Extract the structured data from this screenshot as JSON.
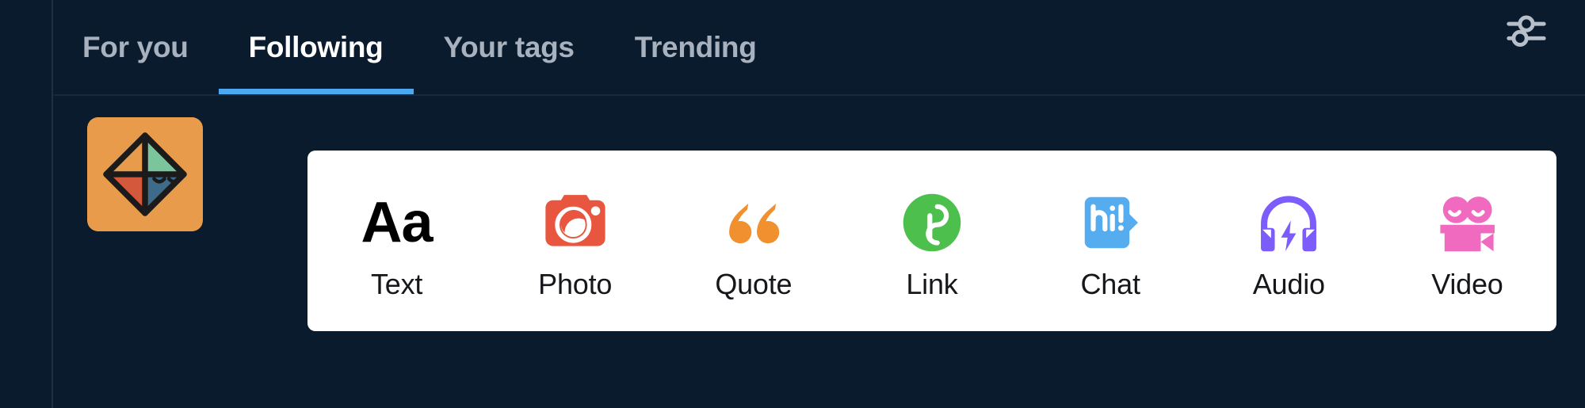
{
  "theme": {
    "background": "#0b1b2e",
    "divider": "#1e3047",
    "accent": "#4ca8f0",
    "tab_inactive": "#a8b2be",
    "tab_active": "#ffffff",
    "card_background": "#ffffff",
    "label_color": "#15171a"
  },
  "header": {
    "tabs": [
      {
        "label": "For you",
        "active": false
      },
      {
        "label": "Following",
        "active": true
      },
      {
        "label": "Your tags",
        "active": false
      },
      {
        "label": "Trending",
        "active": false
      }
    ],
    "filter_icon": "sliders-filter-icon"
  },
  "composer": {
    "avatar": {
      "icon": "octahedron-avatar",
      "background": "#e89b4a",
      "facet_colors": {
        "left": "#e89b4a",
        "right": "#7cc49b",
        "bottom_left": "#d4583c",
        "bottom_right": "#3f6b8a"
      },
      "outline": "#1b1b1b"
    },
    "post_types": [
      {
        "label": "Text",
        "icon": "text-aa-icon",
        "color": "#000000",
        "glyph": "Aa"
      },
      {
        "label": "Photo",
        "icon": "camera-icon",
        "color": "#e8563f"
      },
      {
        "label": "Quote",
        "icon": "quote-marks-icon",
        "color": "#f0902f"
      },
      {
        "label": "Link",
        "icon": "link-icon",
        "color": "#4cbf4c"
      },
      {
        "label": "Chat",
        "icon": "chat-bubble-icon",
        "color": "#55acee",
        "glyph": "hi!"
      },
      {
        "label": "Audio",
        "icon": "headphones-icon",
        "color": "#7c5cfa"
      },
      {
        "label": "Video",
        "icon": "video-camera-icon",
        "color": "#f06bc0"
      }
    ]
  }
}
